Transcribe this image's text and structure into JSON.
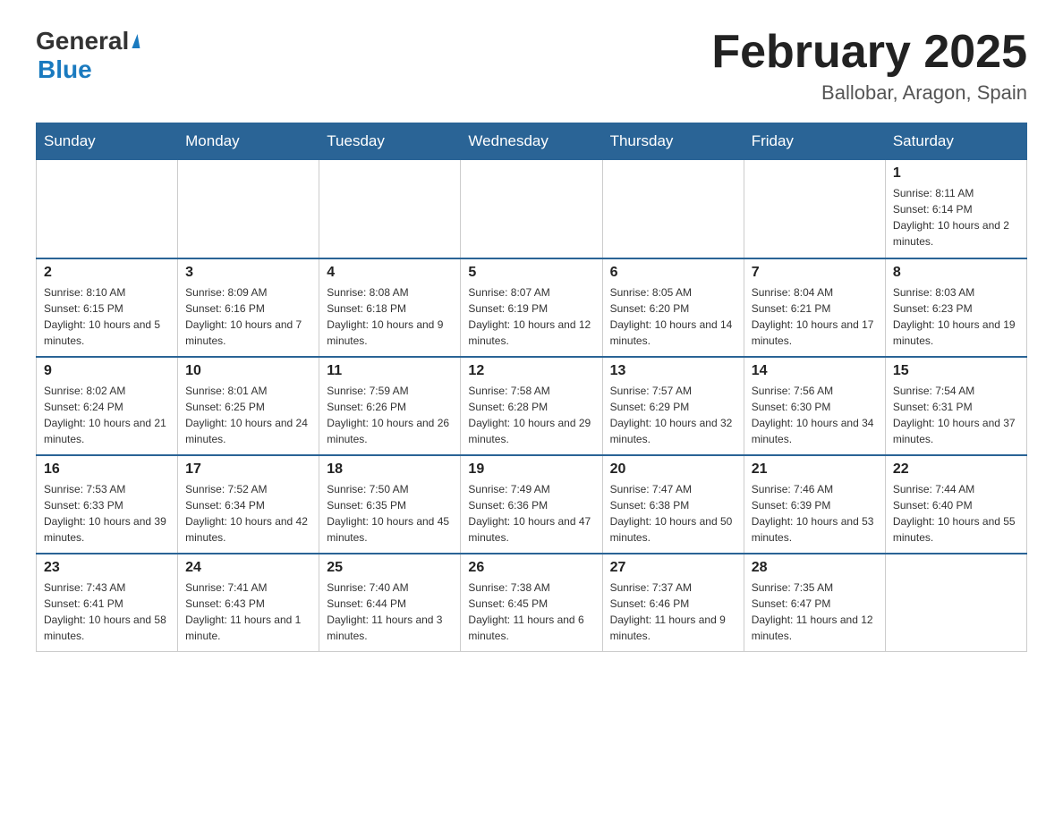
{
  "header": {
    "logo_text_black": "General",
    "logo_text_blue": "Blue",
    "month_title": "February 2025",
    "location": "Ballobar, Aragon, Spain"
  },
  "weekdays": [
    "Sunday",
    "Monday",
    "Tuesday",
    "Wednesday",
    "Thursday",
    "Friday",
    "Saturday"
  ],
  "weeks": [
    [
      {
        "day": "",
        "info": ""
      },
      {
        "day": "",
        "info": ""
      },
      {
        "day": "",
        "info": ""
      },
      {
        "day": "",
        "info": ""
      },
      {
        "day": "",
        "info": ""
      },
      {
        "day": "",
        "info": ""
      },
      {
        "day": "1",
        "info": "Sunrise: 8:11 AM\nSunset: 6:14 PM\nDaylight: 10 hours and 2 minutes."
      }
    ],
    [
      {
        "day": "2",
        "info": "Sunrise: 8:10 AM\nSunset: 6:15 PM\nDaylight: 10 hours and 5 minutes."
      },
      {
        "day": "3",
        "info": "Sunrise: 8:09 AM\nSunset: 6:16 PM\nDaylight: 10 hours and 7 minutes."
      },
      {
        "day": "4",
        "info": "Sunrise: 8:08 AM\nSunset: 6:18 PM\nDaylight: 10 hours and 9 minutes."
      },
      {
        "day": "5",
        "info": "Sunrise: 8:07 AM\nSunset: 6:19 PM\nDaylight: 10 hours and 12 minutes."
      },
      {
        "day": "6",
        "info": "Sunrise: 8:05 AM\nSunset: 6:20 PM\nDaylight: 10 hours and 14 minutes."
      },
      {
        "day": "7",
        "info": "Sunrise: 8:04 AM\nSunset: 6:21 PM\nDaylight: 10 hours and 17 minutes."
      },
      {
        "day": "8",
        "info": "Sunrise: 8:03 AM\nSunset: 6:23 PM\nDaylight: 10 hours and 19 minutes."
      }
    ],
    [
      {
        "day": "9",
        "info": "Sunrise: 8:02 AM\nSunset: 6:24 PM\nDaylight: 10 hours and 21 minutes."
      },
      {
        "day": "10",
        "info": "Sunrise: 8:01 AM\nSunset: 6:25 PM\nDaylight: 10 hours and 24 minutes."
      },
      {
        "day": "11",
        "info": "Sunrise: 7:59 AM\nSunset: 6:26 PM\nDaylight: 10 hours and 26 minutes."
      },
      {
        "day": "12",
        "info": "Sunrise: 7:58 AM\nSunset: 6:28 PM\nDaylight: 10 hours and 29 minutes."
      },
      {
        "day": "13",
        "info": "Sunrise: 7:57 AM\nSunset: 6:29 PM\nDaylight: 10 hours and 32 minutes."
      },
      {
        "day": "14",
        "info": "Sunrise: 7:56 AM\nSunset: 6:30 PM\nDaylight: 10 hours and 34 minutes."
      },
      {
        "day": "15",
        "info": "Sunrise: 7:54 AM\nSunset: 6:31 PM\nDaylight: 10 hours and 37 minutes."
      }
    ],
    [
      {
        "day": "16",
        "info": "Sunrise: 7:53 AM\nSunset: 6:33 PM\nDaylight: 10 hours and 39 minutes."
      },
      {
        "day": "17",
        "info": "Sunrise: 7:52 AM\nSunset: 6:34 PM\nDaylight: 10 hours and 42 minutes."
      },
      {
        "day": "18",
        "info": "Sunrise: 7:50 AM\nSunset: 6:35 PM\nDaylight: 10 hours and 45 minutes."
      },
      {
        "day": "19",
        "info": "Sunrise: 7:49 AM\nSunset: 6:36 PM\nDaylight: 10 hours and 47 minutes."
      },
      {
        "day": "20",
        "info": "Sunrise: 7:47 AM\nSunset: 6:38 PM\nDaylight: 10 hours and 50 minutes."
      },
      {
        "day": "21",
        "info": "Sunrise: 7:46 AM\nSunset: 6:39 PM\nDaylight: 10 hours and 53 minutes."
      },
      {
        "day": "22",
        "info": "Sunrise: 7:44 AM\nSunset: 6:40 PM\nDaylight: 10 hours and 55 minutes."
      }
    ],
    [
      {
        "day": "23",
        "info": "Sunrise: 7:43 AM\nSunset: 6:41 PM\nDaylight: 10 hours and 58 minutes."
      },
      {
        "day": "24",
        "info": "Sunrise: 7:41 AM\nSunset: 6:43 PM\nDaylight: 11 hours and 1 minute."
      },
      {
        "day": "25",
        "info": "Sunrise: 7:40 AM\nSunset: 6:44 PM\nDaylight: 11 hours and 3 minutes."
      },
      {
        "day": "26",
        "info": "Sunrise: 7:38 AM\nSunset: 6:45 PM\nDaylight: 11 hours and 6 minutes."
      },
      {
        "day": "27",
        "info": "Sunrise: 7:37 AM\nSunset: 6:46 PM\nDaylight: 11 hours and 9 minutes."
      },
      {
        "day": "28",
        "info": "Sunrise: 7:35 AM\nSunset: 6:47 PM\nDaylight: 11 hours and 12 minutes."
      },
      {
        "day": "",
        "info": ""
      }
    ]
  ]
}
